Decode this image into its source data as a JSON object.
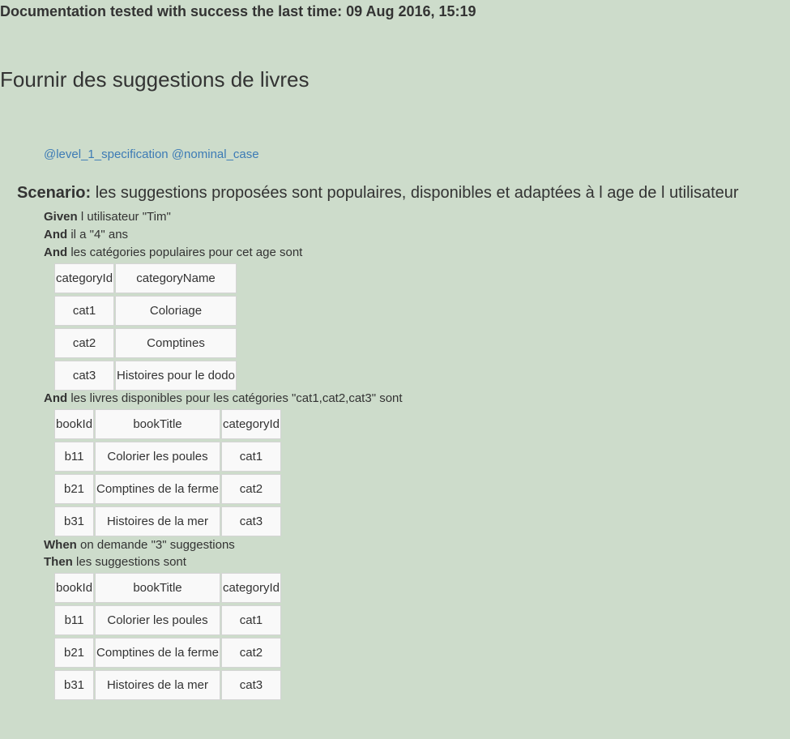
{
  "header": {
    "tested": "Documentation tested with success the last time: 09 Aug 2016, 15:19"
  },
  "feature": {
    "title": "Fournir des suggestions de livres"
  },
  "tags": [
    "@level_1_specification",
    "@nominal_case"
  ],
  "scenario": {
    "keyword": "Scenario:",
    "name": "les suggestions proposées sont populaires, disponibles et adaptées à l age de l utilisateur"
  },
  "steps": [
    {
      "keyword": "Given",
      "text": "l utilisateur \"Tim\""
    },
    {
      "keyword": "And",
      "text": "il a \"4\" ans"
    },
    {
      "keyword": "And",
      "text": "les catégories populaires pour cet age sont"
    },
    {
      "keyword": "And",
      "text": "les livres disponibles pour les catégories \"cat1,cat2,cat3\" sont"
    },
    {
      "keyword": "When",
      "text": "on demande \"3\" suggestions"
    },
    {
      "keyword": "Then",
      "text": "les suggestions sont"
    }
  ],
  "tables": {
    "categories": {
      "rows": [
        [
          "categoryId",
          "categoryName"
        ],
        [
          "cat1",
          "Coloriage"
        ],
        [
          "cat2",
          "Comptines"
        ],
        [
          "cat3",
          "Histoires pour le dodo"
        ]
      ]
    },
    "books": {
      "rows": [
        [
          "bookId",
          "bookTitle",
          "categoryId"
        ],
        [
          "b11",
          "Colorier les poules",
          "cat1"
        ],
        [
          "b21",
          "Comptines de la ferme",
          "cat2"
        ],
        [
          "b31",
          "Histoires de la mer",
          "cat3"
        ]
      ]
    },
    "suggestions": {
      "rows": [
        [
          "bookId",
          "bookTitle",
          "categoryId"
        ],
        [
          "b11",
          "Colorier les poules",
          "cat1"
        ],
        [
          "b21",
          "Comptines de la ferme",
          "cat2"
        ],
        [
          "b31",
          "Histoires de la mer",
          "cat3"
        ]
      ]
    }
  }
}
